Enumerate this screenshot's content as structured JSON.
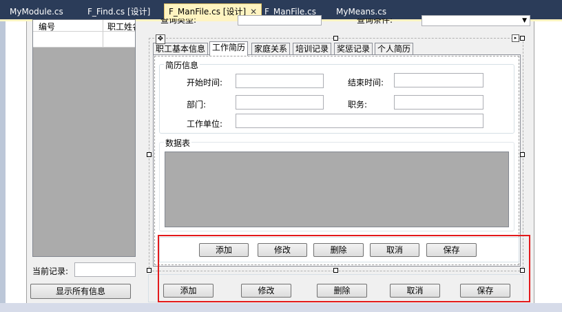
{
  "tabs": [
    {
      "label": "MyModule.cs"
    },
    {
      "label": "F_Find.cs [设计]"
    },
    {
      "label": "F_ManFile.cs [设计]"
    },
    {
      "label": "F_ManFile.cs"
    },
    {
      "label": "MyMeans.cs"
    }
  ],
  "active_tab_index": 2,
  "close_glyph": "✕",
  "top_labels": {
    "query_type": "查询类型:",
    "query_condition": "查询条件:"
  },
  "grid": {
    "columns": [
      "编号",
      "职工姓名"
    ]
  },
  "left": {
    "current_record_label": "当前记录:",
    "show_all_button": "显示所有信息"
  },
  "form_tabs": [
    "职工基本信息",
    "工作简历",
    "家庭关系",
    "培训记录",
    "奖惩记录",
    "个人简历"
  ],
  "selected_form_tab": "工作简历",
  "resume_group": {
    "title": "简历信息",
    "start_time": "开始时间:",
    "end_time": "结束时间:",
    "department": "部门:",
    "position": "职务:",
    "work_unit": "工作单位:"
  },
  "data_group": {
    "title": "数据表"
  },
  "inner_buttons": [
    "添加",
    "修改",
    "删除",
    "取消",
    "保存"
  ],
  "outer_buttons": [
    "添加",
    "修改",
    "删除",
    "取消",
    "保存"
  ],
  "colors": {
    "highlight": "#e3191b",
    "tab_bar": "#2b3c59",
    "active_tab": "#fff4c1",
    "grid_body": "#ababab"
  }
}
